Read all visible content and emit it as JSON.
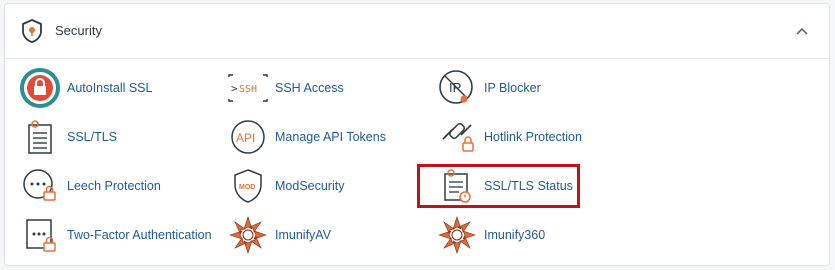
{
  "section": {
    "title": "Security",
    "header_icon": "shield-icon",
    "collapse_icon": "chevron-up-icon"
  },
  "items": [
    {
      "label": "AutoInstall SSL",
      "icon": "autoinstall-ssl-icon"
    },
    {
      "label": "SSH Access",
      "icon": "ssh-terminal-icon"
    },
    {
      "label": "IP Blocker",
      "icon": "ip-blocker-icon"
    },
    {
      "label": "SSL/TLS",
      "icon": "certificate-icon"
    },
    {
      "label": "Manage API Tokens",
      "icon": "api-icon"
    },
    {
      "label": "Hotlink Protection",
      "icon": "hotlink-lock-icon"
    },
    {
      "label": "Leech Protection",
      "icon": "leech-lock-icon"
    },
    {
      "label": "ModSecurity",
      "icon": "modsecurity-shield-icon"
    },
    {
      "label": "SSL/TLS Status",
      "icon": "ssl-status-icon"
    },
    {
      "label": "Two-Factor Authentication",
      "icon": "two-factor-lock-icon"
    },
    {
      "label": "ImunifyAV",
      "icon": "imunifyav-icon"
    },
    {
      "label": "Imunify360",
      "icon": "imunify360-icon"
    }
  ],
  "colors": {
    "accent_orange": "#e8703a",
    "icon_dark": "#2d3a45",
    "link": "#1f5a9a",
    "highlight": "#c1121a"
  }
}
